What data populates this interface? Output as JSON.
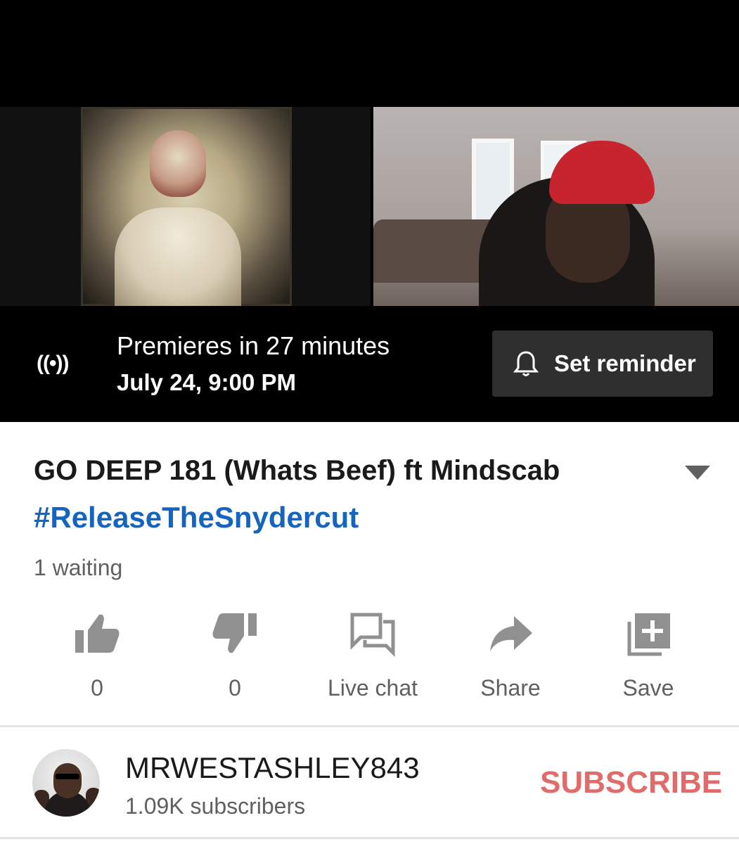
{
  "premiere": {
    "title": "Premieres in 27 minutes",
    "date": "July 24, 9:00 PM",
    "live_icon_text": "((•))",
    "reminder_label": "Set reminder"
  },
  "video": {
    "title": "GO DEEP 181 (Whats Beef) ft Mindscab",
    "hashtag": "#ReleaseTheSnydercut",
    "waiting": "1 waiting"
  },
  "actions": [
    {
      "icon": "thumbs-up-icon",
      "label": "0"
    },
    {
      "icon": "thumbs-down-icon",
      "label": "0"
    },
    {
      "icon": "live-chat-icon",
      "label": "Live chat"
    },
    {
      "icon": "share-icon",
      "label": "Share"
    },
    {
      "icon": "save-playlist-icon",
      "label": "Save"
    }
  ],
  "channel": {
    "name": "MRWESTASHLEY843",
    "subscribers": "1.09K subscribers",
    "subscribe_label": "SUBSCRIBE"
  },
  "colors": {
    "hashtag": "#1565c0",
    "subscribe": "#e16a6a",
    "secondary_text": "#606060",
    "icon_gray": "#909090"
  }
}
